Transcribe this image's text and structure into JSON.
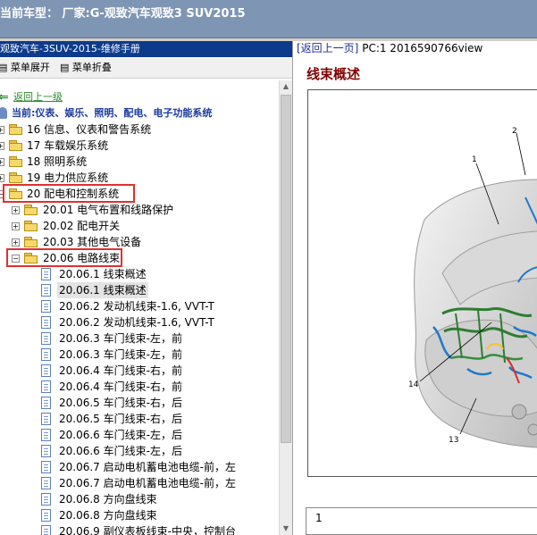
{
  "window": {
    "title": "当前车型：  厂家:G-观致汽车观致3 SUV2015"
  },
  "left_pane": {
    "header": "观致汽车-3SUV-2015-维修手册",
    "toolbar": {
      "expand_label": "菜单展开",
      "collapse_label": "菜单折叠"
    },
    "back_label": "返回上一级",
    "current_label": "当前:仪表、娱乐、照明、配电、电子功能系统",
    "tree": [
      {
        "label": "16 信息、仪表和警告系统"
      },
      {
        "label": "17 车载娱乐系统"
      },
      {
        "label": "18 照明系统"
      },
      {
        "label": "19 电力供应系统"
      },
      {
        "label": "20 配电和控制系统"
      },
      {
        "label": "20.01 电气布置和线路保护"
      },
      {
        "label": "20.02 配电开关"
      },
      {
        "label": "20.03 其他电气设备"
      },
      {
        "label": "20.06 电路线束"
      },
      {
        "label": "20.06.1 线束概述"
      },
      {
        "label": "20.06.1 线束概述"
      },
      {
        "label": "20.06.2 发动机线束-1.6, VVT-T"
      },
      {
        "label": "20.06.2 发动机线束-1.6, VVT-T"
      },
      {
        "label": "20.06.3 车门线束-左，前"
      },
      {
        "label": "20.06.3 车门线束-左，前"
      },
      {
        "label": "20.06.4 车门线束-右，前"
      },
      {
        "label": "20.06.4 车门线束-右，前"
      },
      {
        "label": "20.06.5 车门线束-右，后"
      },
      {
        "label": "20.06.5 车门线束-右，后"
      },
      {
        "label": "20.06.6 车门线束-左，后"
      },
      {
        "label": "20.06.6 车门线束-左，后"
      },
      {
        "label": "20.06.7 启动电机蓄电池电缆-前，左"
      },
      {
        "label": "20.06.7 启动电机蓄电池电缆-前，左"
      },
      {
        "label": "20.06.8 方向盘线束"
      },
      {
        "label": "20.06.8 方向盘线束"
      },
      {
        "label": "20.06.9 副仪表板线束-中央，控制台"
      }
    ]
  },
  "right_pane": {
    "back_link": "[返回上一页]",
    "pc_info": "PC:1 2016590766view",
    "title": "线束概述",
    "callouts": [
      "1",
      "2",
      "13",
      "14"
    ],
    "page_number": "1"
  }
}
